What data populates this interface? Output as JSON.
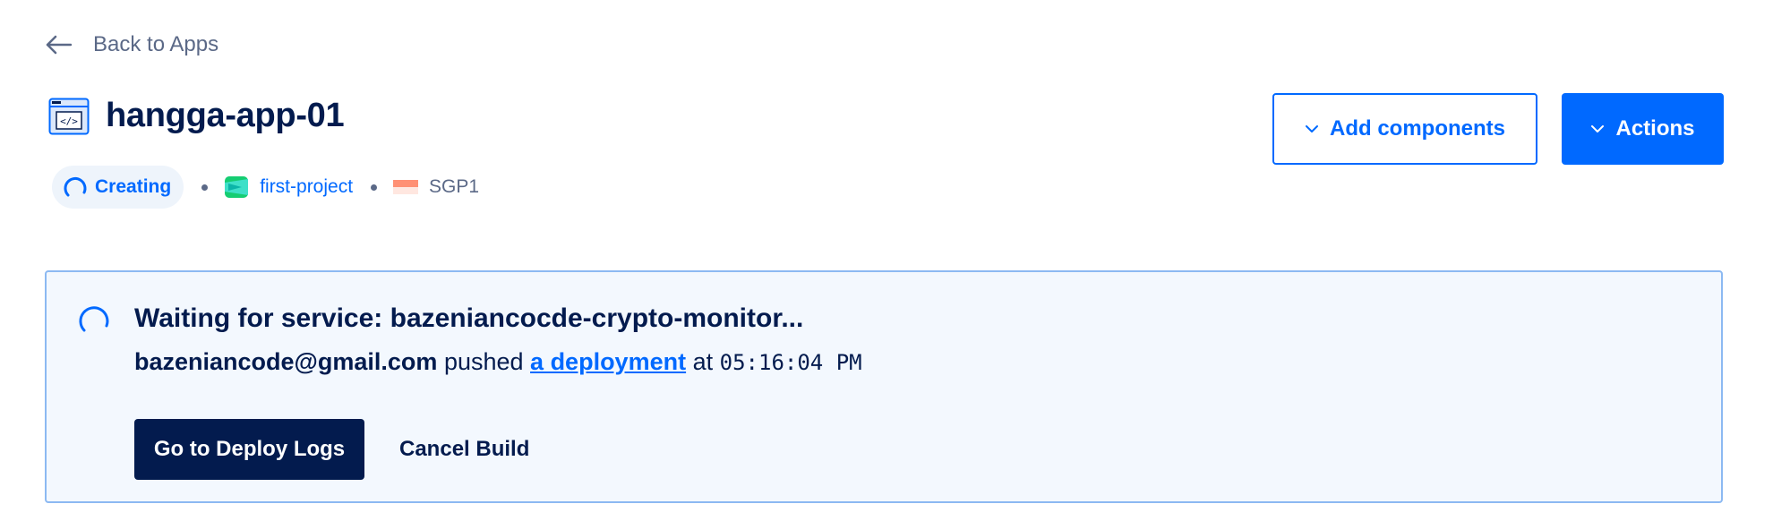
{
  "nav": {
    "back_label": "Back to Apps",
    "back_icon": "arrow-left-icon"
  },
  "app": {
    "name": "hangga-app-01",
    "icon": "code-window-icon",
    "status": "Creating",
    "project": "first-project",
    "region": "SGP1"
  },
  "header_actions": {
    "add_components_label": "Add components",
    "actions_label": "Actions"
  },
  "banner": {
    "title": "Waiting for service: bazeniancocde-crypto-monitor...",
    "email": "bazeniancode@gmail.com",
    "pushed_text": "pushed",
    "link_text": "a deployment",
    "at_text": "at",
    "time": "05:16:04 PM",
    "deploy_logs_label": "Go to Deploy Logs",
    "cancel_label": "Cancel Build"
  },
  "colors": {
    "primary": "#0069ff",
    "navy": "#031b4e",
    "muted": "#5b6987",
    "banner_bg": "#f3f8fe",
    "banner_border": "#8cb9f2"
  }
}
